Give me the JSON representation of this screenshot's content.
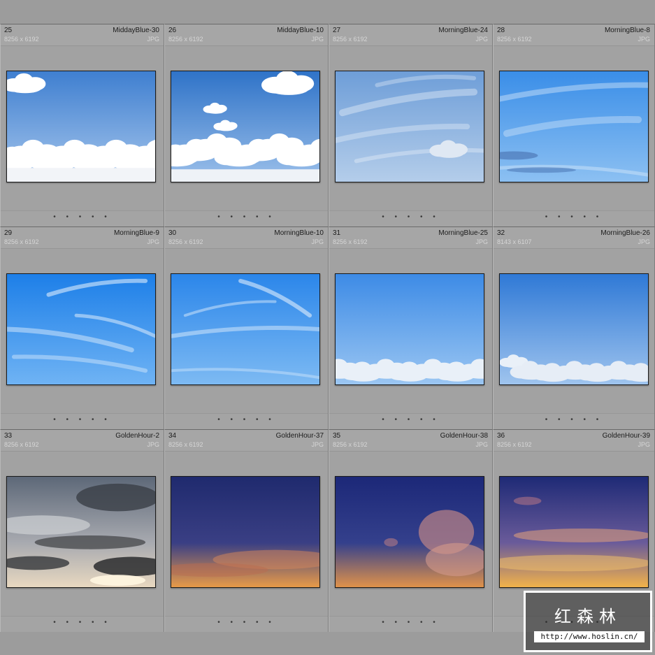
{
  "grid": {
    "cells": [
      {
        "index": "25",
        "name": "MiddayBlue-30",
        "dims": "8256 x 6192",
        "type": "JPG",
        "sky": "cumulus",
        "rating": "• • • • •"
      },
      {
        "index": "26",
        "name": "MiddayBlue-10",
        "dims": "8256 x 6192",
        "type": "JPG",
        "sky": "cumulus2",
        "rating": "• • • • •"
      },
      {
        "index": "27",
        "name": "MorningBlue-24",
        "dims": "8256 x 6192",
        "type": "JPG",
        "sky": "cirrus-pale",
        "rating": "• • • • •"
      },
      {
        "index": "28",
        "name": "MorningBlue-8",
        "dims": "8256 x 6192",
        "type": "JPG",
        "sky": "cirrus-bright",
        "rating": "• • • • •"
      },
      {
        "index": "29",
        "name": "MorningBlue-9",
        "dims": "8256 x 6192",
        "type": "JPG",
        "sky": "wispy",
        "rating": "• • • • •"
      },
      {
        "index": "30",
        "name": "MorningBlue-10",
        "dims": "8256 x 6192",
        "type": "JPG",
        "sky": "wispy2",
        "rating": "• • • • •"
      },
      {
        "index": "31",
        "name": "MorningBlue-25",
        "dims": "8256 x 6192",
        "type": "JPG",
        "sky": "clear-low",
        "rating": "• • • • •"
      },
      {
        "index": "32",
        "name": "MorningBlue-26",
        "dims": "8143 x 6107",
        "type": "JPG",
        "sky": "clear-low2",
        "rating": "• • • • •"
      },
      {
        "index": "33",
        "name": "GoldenHour-2",
        "dims": "8256 x 6192",
        "type": "JPG",
        "sky": "stormy",
        "rating": "• • • • •"
      },
      {
        "index": "34",
        "name": "GoldenHour-37",
        "dims": "8256 x 6192",
        "type": "JPG",
        "sky": "dusk",
        "rating": "• • • • •"
      },
      {
        "index": "35",
        "name": "GoldenHour-38",
        "dims": "8256 x 6192",
        "type": "JPG",
        "sky": "dusk-cloud",
        "rating": "• • • • •"
      },
      {
        "index": "36",
        "name": "GoldenHour-39",
        "dims": "8256 x 6192",
        "type": "JPG",
        "sky": "sunset",
        "rating": "• • • • •"
      }
    ]
  },
  "watermark": {
    "title": "红森林",
    "url": "http://www.hoslin.cn/"
  }
}
